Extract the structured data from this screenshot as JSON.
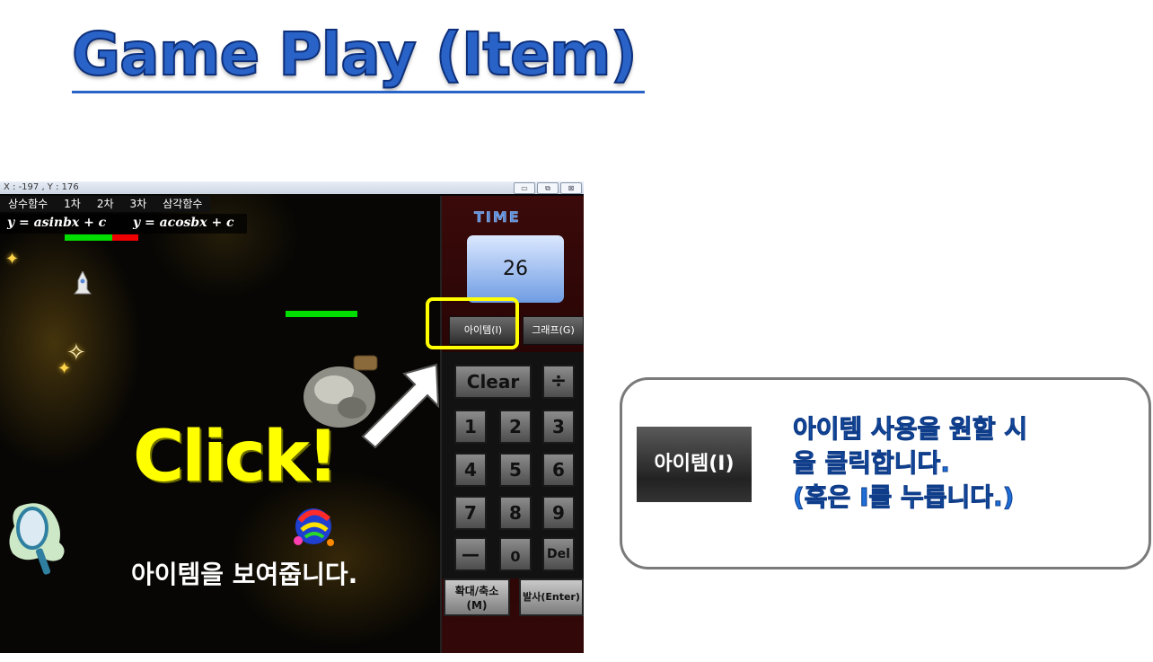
{
  "slide": {
    "title": "Game Play (Item)"
  },
  "window": {
    "coords": "X : -197 , Y : 176",
    "buttons": [
      "▭",
      "⧉",
      "⊠"
    ]
  },
  "menu": {
    "items": [
      "상수함수",
      "1차",
      "2차",
      "3차",
      "삼각함수"
    ]
  },
  "formulas": {
    "sin": "y = asinbx + c",
    "cos": "y = acosbx + c"
  },
  "colors": {
    "health_green": "#00dd00",
    "health_red": "#ee0000",
    "highlight": "#ffff00",
    "info_text": "#1e6ed8"
  },
  "player_health": {
    "fraction": 0.65
  },
  "overlay": {
    "click_text": "Click!",
    "caption": "아이템을 보여줍니다."
  },
  "panel": {
    "time_label": "TIME",
    "time_value": "26",
    "item_button": "아이템(I)",
    "graph_button": "그래프(G)",
    "keys": {
      "clear": "Clear",
      "divide": "÷",
      "digits": [
        "1",
        "2",
        "3",
        "4",
        "5",
        "6",
        "7",
        "8",
        "9"
      ],
      "minus": "—",
      "zero": "0",
      "del": "Del"
    },
    "zoom_button": "확대/축소\n(M)",
    "fire_button": "발사(Enter)"
  },
  "info_box": {
    "button_label": "아이템(I)",
    "line1": "아이템 사용을 원할 시",
    "line2": "을 클릭합니다.",
    "line3": "(혹은 I를 누릅니다.)"
  }
}
